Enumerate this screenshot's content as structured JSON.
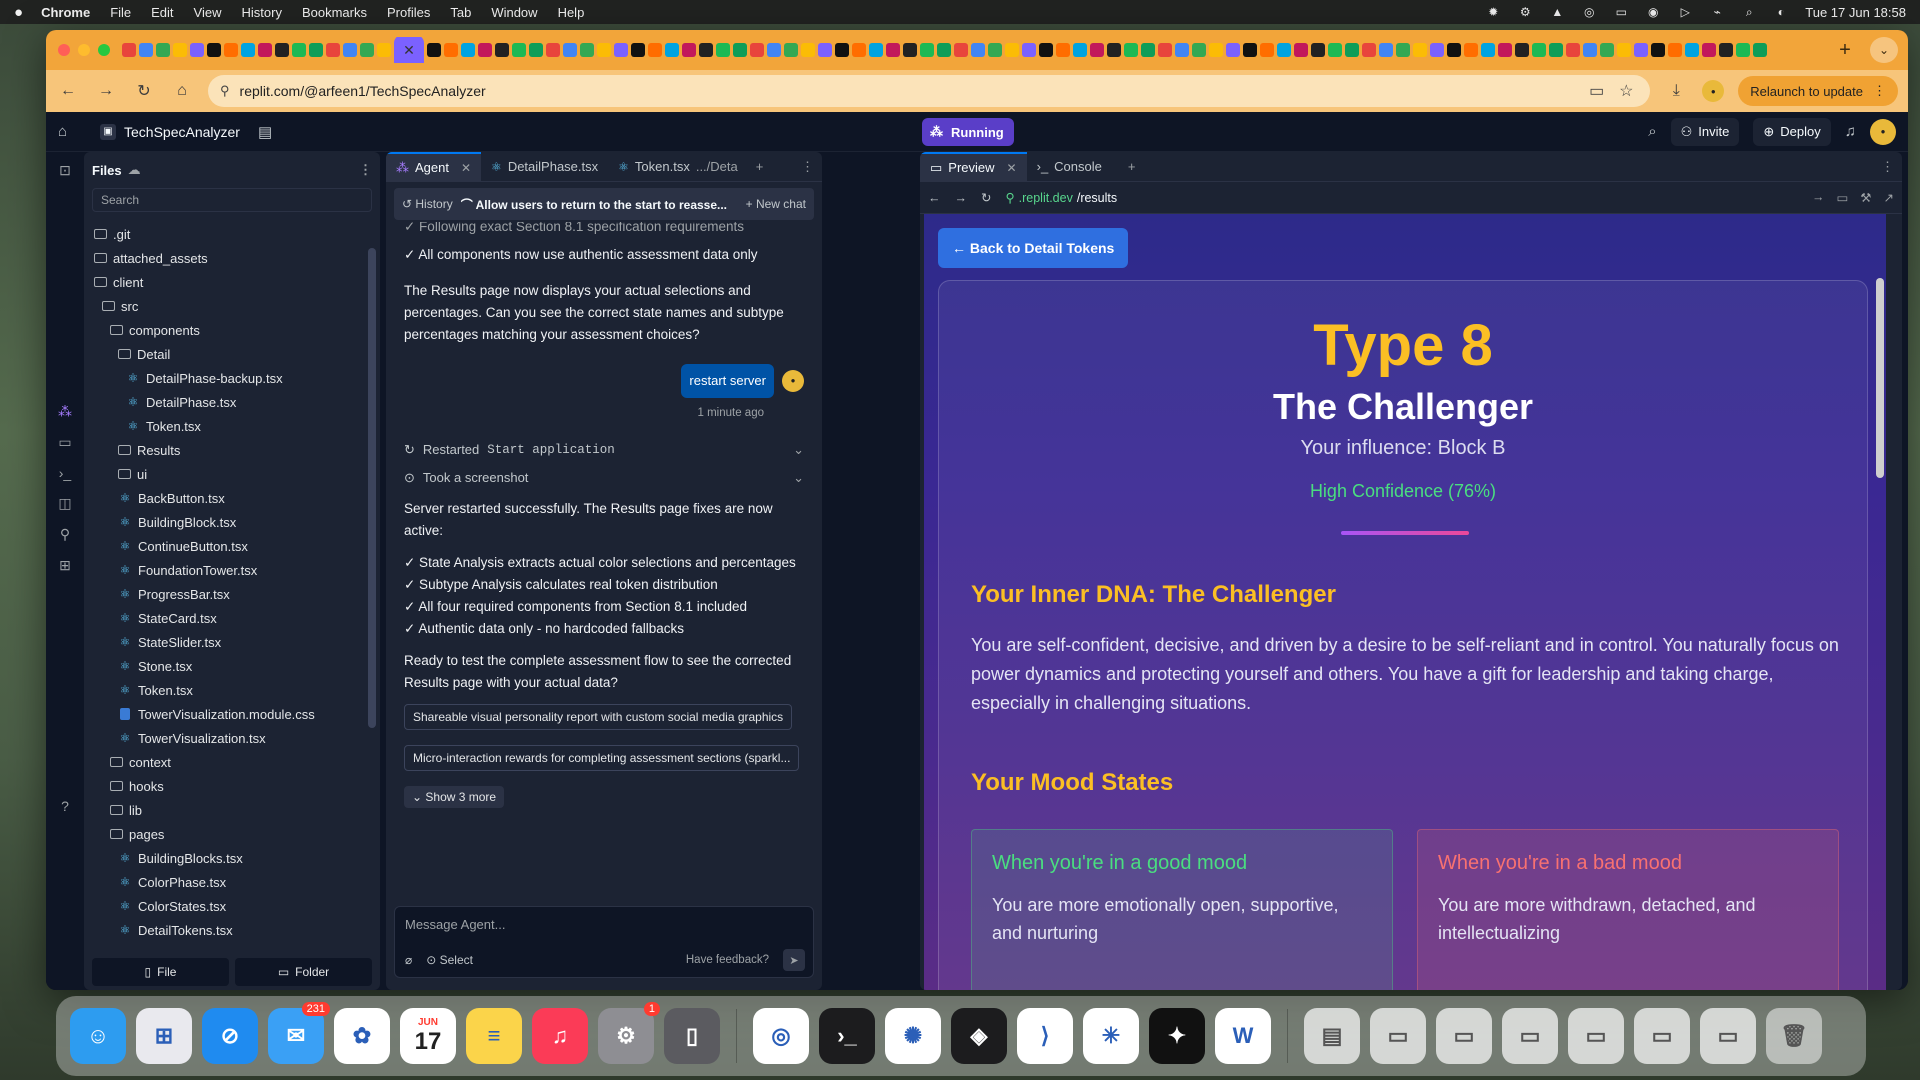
{
  "menubar": {
    "app": "Chrome",
    "items": [
      "File",
      "Edit",
      "View",
      "History",
      "Bookmarks",
      "Profiles",
      "Tab",
      "Window",
      "Help"
    ],
    "datetime": "Tue 17 Jun  18:58"
  },
  "browser": {
    "url": "replit.com/@arfeen1/TechSpecAnalyzer",
    "relaunch_label": "Relaunch to update"
  },
  "replit": {
    "project_name": "TechSpecAnalyzer",
    "run_status": "Running",
    "invite_label": "Invite",
    "deploy_label": "Deploy"
  },
  "files": {
    "title": "Files",
    "search_placeholder": "Search",
    "tree": [
      {
        "name": ".git",
        "type": "folder",
        "depth": 0
      },
      {
        "name": "attached_assets",
        "type": "folder",
        "depth": 0
      },
      {
        "name": "client",
        "type": "folder",
        "depth": 0
      },
      {
        "name": "src",
        "type": "folder",
        "depth": 1
      },
      {
        "name": "components",
        "type": "folder",
        "depth": 2
      },
      {
        "name": "Detail",
        "type": "folder",
        "depth": 3
      },
      {
        "name": "DetailPhase-backup.tsx",
        "type": "react",
        "depth": 4
      },
      {
        "name": "DetailPhase.tsx",
        "type": "react",
        "depth": 4
      },
      {
        "name": "Token.tsx",
        "type": "react",
        "depth": 4
      },
      {
        "name": "Results",
        "type": "folder",
        "depth": 3
      },
      {
        "name": "ui",
        "type": "folder",
        "depth": 3
      },
      {
        "name": "BackButton.tsx",
        "type": "react",
        "depth": 3
      },
      {
        "name": "BuildingBlock.tsx",
        "type": "react",
        "depth": 3
      },
      {
        "name": "ContinueButton.tsx",
        "type": "react",
        "depth": 3
      },
      {
        "name": "FoundationTower.tsx",
        "type": "react",
        "depth": 3
      },
      {
        "name": "ProgressBar.tsx",
        "type": "react",
        "depth": 3
      },
      {
        "name": "StateCard.tsx",
        "type": "react",
        "depth": 3
      },
      {
        "name": "StateSlider.tsx",
        "type": "react",
        "depth": 3
      },
      {
        "name": "Stone.tsx",
        "type": "react",
        "depth": 3
      },
      {
        "name": "Token.tsx",
        "type": "react",
        "depth": 3
      },
      {
        "name": "TowerVisualization.module.css",
        "type": "css",
        "depth": 3
      },
      {
        "name": "TowerVisualization.tsx",
        "type": "react",
        "depth": 3
      },
      {
        "name": "context",
        "type": "folder",
        "depth": 2
      },
      {
        "name": "hooks",
        "type": "folder",
        "depth": 2
      },
      {
        "name": "lib",
        "type": "folder",
        "depth": 2
      },
      {
        "name": "pages",
        "type": "folder",
        "depth": 2
      },
      {
        "name": "BuildingBlocks.tsx",
        "type": "react",
        "depth": 3
      },
      {
        "name": "ColorPhase.tsx",
        "type": "react",
        "depth": 3
      },
      {
        "name": "ColorStates.tsx",
        "type": "react",
        "depth": 3
      },
      {
        "name": "DetailTokens.tsx",
        "type": "react",
        "depth": 3
      }
    ],
    "new_file_label": "File",
    "new_folder_label": "Folder"
  },
  "agent": {
    "tabs": [
      {
        "label": "Agent",
        "active": true
      },
      {
        "label": "DetailPhase.tsx",
        "active": false
      },
      {
        "label": "Token.tsx",
        "suffix": ".../Deta",
        "active": false
      }
    ],
    "history_label": "History",
    "chat_title": "Allow users to return to the start to reasse...",
    "new_chat_label": "New chat",
    "msg_top_faded": "✓ Following exact Section 8.1 specification requirements",
    "msg_top_line": "✓ All components now use authentic assessment data only",
    "msg_results": "The Results page now displays your actual selections and percentages. Can you see the correct state names and subtype percentages matching your assessment choices?",
    "user_message": "restart server",
    "user_time": "1 minute ago",
    "action_restart": "Restarted",
    "action_restart_code": "Start application",
    "action_screenshot": "Took a screenshot",
    "msg_server": "Server restarted successfully. The Results page fixes are now active:",
    "checks": [
      "✓ State Analysis extracts actual color selections and percentages",
      "✓ Subtype Analysis calculates real token distribution",
      "✓ All four required components from Section 8.1 included",
      "✓ Authentic data only - no hardcoded fallbacks"
    ],
    "msg_ready": "Ready to test the complete assessment flow to see the corrected Results page with your actual data?",
    "suggestions": [
      "Shareable visual personality report with custom social media graphics",
      "Micro-interaction rewards for completing assessment sections (sparkl..."
    ],
    "show_more_label": "Show 3 more",
    "input_placeholder": "Message Agent...",
    "select_label": "Select",
    "feedback_label": "Have feedback?"
  },
  "preview": {
    "tabs": [
      {
        "label": "Preview",
        "active": true
      },
      {
        "label": "Console",
        "active": false
      }
    ],
    "url_domain": ".replit.dev",
    "url_path": "/results",
    "back_label": "← Back to Detail Tokens",
    "type_title": "Type 8",
    "type_name": "The Challenger",
    "influence": "Your influence: Block B",
    "confidence": "High Confidence (76%)",
    "dna_heading": "Your Inner DNA: The Challenger",
    "dna_text": "You are self-confident, decisive, and driven by a desire to be self-reliant and in control. You naturally focus on power dynamics and protecting yourself and others. You have a gift for leadership and taking charge, especially in challenging situations.",
    "mood_heading": "Your Mood States",
    "good_title": "When you're in a good mood",
    "good_text": "You are more emotionally open, supportive, and nurturing",
    "bad_title": "When you're in a bad mood",
    "bad_text": "You are more withdrawn, detached, and intellectualizing",
    "colors": {
      "accent": "#fbbf24",
      "good": "#4ade80",
      "bad": "#f87171",
      "button": "#2f6fe0"
    }
  },
  "dock": {
    "apps": [
      "finder-icon",
      "launchpad-icon",
      "safari-icon",
      "mail-icon",
      "photos-icon",
      "calendar-icon",
      "notes-icon",
      "music-icon",
      "settings-icon",
      "iphone-mirroring-icon",
      "chrome-icon",
      "terminal-icon",
      "chatgpt-icon",
      "unity-icon",
      "vscode-icon",
      "claude-icon",
      "perplexity-icon",
      "word-icon"
    ],
    "mail_badge": "231",
    "settings_badge": "1",
    "calendar_month": "JUN",
    "calendar_day": "17"
  }
}
